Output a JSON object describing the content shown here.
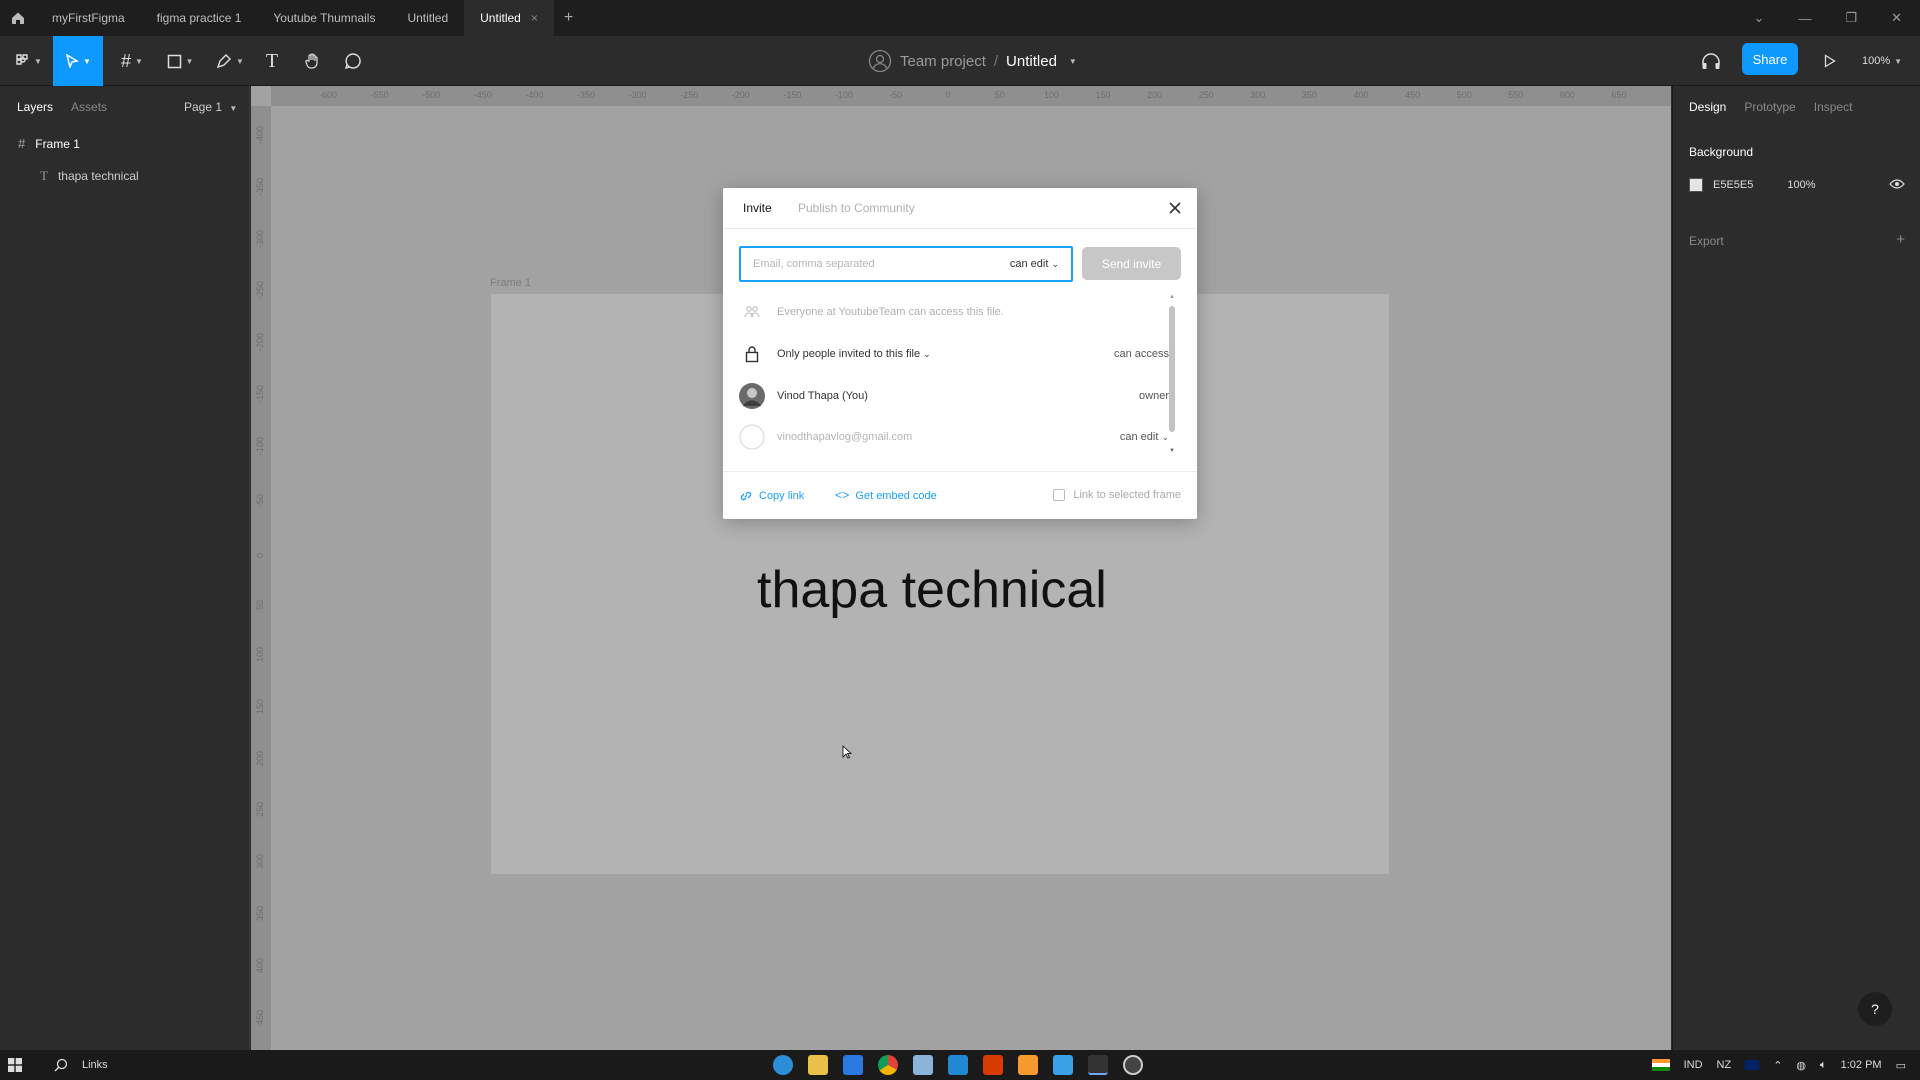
{
  "tabs": [
    {
      "label": "myFirstFigma"
    },
    {
      "label": "figma practice 1"
    },
    {
      "label": "Youtube Thumnails"
    },
    {
      "label": "Untitled"
    },
    {
      "label": "Untitled"
    }
  ],
  "toolbar": {
    "team": "Team project",
    "separator": "/",
    "file_name": "Untitled",
    "share": "Share",
    "zoom": "100%"
  },
  "left_panel": {
    "tab_layers": "Layers",
    "tab_assets": "Assets",
    "page": "Page 1",
    "layers": [
      {
        "name": "Frame 1"
      },
      {
        "name": "thapa technical"
      }
    ]
  },
  "right_panel": {
    "tab_design": "Design",
    "tab_prototype": "Prototype",
    "tab_inspect": "Inspect",
    "background_title": "Background",
    "background_hex": "E5E5E5",
    "background_opacity": "100%",
    "export_title": "Export"
  },
  "rulers": {
    "horizontal": [
      "-600",
      "-550",
      "-500",
      "-450",
      "-400",
      "-350",
      "-300",
      "-250",
      "-200",
      "-150",
      "-100",
      "-50",
      "0",
      "50",
      "100",
      "150",
      "200",
      "250",
      "300",
      "350",
      "400",
      "450",
      "500",
      "550",
      "600",
      "650"
    ],
    "vertical": [
      "-400",
      "-350",
      "-300",
      "-250",
      "-200",
      "-150",
      "-100",
      "-50",
      "0",
      "50",
      "100",
      "150",
      "200",
      "250",
      "300",
      "350",
      "400",
      "450"
    ]
  },
  "canvas": {
    "frame_label": "Frame 1",
    "frame_text": "thapa technical"
  },
  "modal": {
    "tab_invite": "Invite",
    "tab_publish": "Publish to Community",
    "email_placeholder": "Email, comma separated",
    "email_permission": "can edit",
    "send_button": "Send invite",
    "rows": [
      {
        "label": "Everyone at YoutubeTeam can access this file.",
        "right": ""
      },
      {
        "label": "Only people invited to this file",
        "right": "can access"
      },
      {
        "label": "Vinod Thapa (You)",
        "right": "owner"
      },
      {
        "label": "vinodthapavlog@gmail.com",
        "right": "can edit"
      }
    ],
    "copy_link": "Copy link",
    "embed_code": "Get embed code",
    "link_frame": "Link to selected frame"
  },
  "taskbar": {
    "search_label": "Links",
    "language": "IND",
    "region": "NZ",
    "time": "1:02 PM"
  },
  "colors": {
    "accent": "#0d99ff",
    "canvas": "#a2a2a2",
    "frame": "#b3b3b3",
    "panel": "#2c2c2c"
  }
}
